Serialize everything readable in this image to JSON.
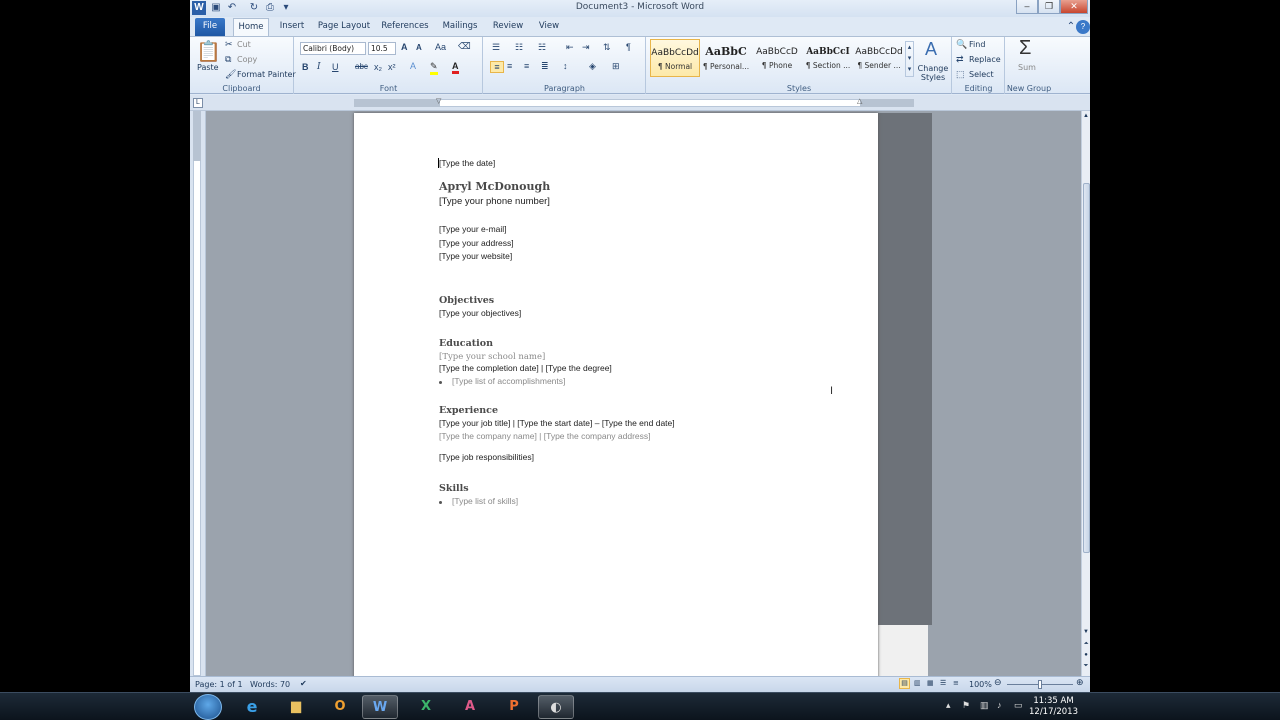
{
  "window": {
    "title": "Document3 - Microsoft Word"
  },
  "tabs": [
    "File",
    "Home",
    "Insert",
    "Page Layout",
    "References",
    "Mailings",
    "Review",
    "View"
  ],
  "clipboard": {
    "paste": "Paste",
    "cut": "Cut",
    "copy": "Copy",
    "format_painter": "Format Painter",
    "label": "Clipboard"
  },
  "font": {
    "name": "Calibri (Body)",
    "size": "10.5",
    "label": "Font",
    "bold": "B",
    "italic": "I",
    "underline": "U",
    "strike": "abc",
    "sub": "x₂",
    "sup": "x²",
    "grow": "A",
    "shrink": "A",
    "clear": "Aa"
  },
  "paragraph": {
    "label": "Paragraph",
    "pilcrow": "¶"
  },
  "styles": {
    "label": "Styles",
    "items": [
      {
        "preview": "AaBbCcDd",
        "name": "¶ Normal"
      },
      {
        "preview": "AaBbC",
        "name": "¶ Personal..."
      },
      {
        "preview": "AaBbCcD",
        "name": "¶ Phone"
      },
      {
        "preview": "AaBbCcI",
        "name": "¶ Section ..."
      },
      {
        "preview": "AaBbCcDd",
        "name": "¶ Sender ..."
      }
    ],
    "change": "Change Styles"
  },
  "editing": {
    "label": "Editing",
    "find": "Find",
    "replace": "Replace",
    "select": "Select"
  },
  "newgroup": {
    "label": "New Group",
    "sum": "Sum"
  },
  "document": {
    "date": "[Type the date]",
    "name": "Apryl McDonough",
    "phone": "[Type your phone number]",
    "email": "[Type your e-mail]",
    "address": "[Type your address]",
    "website": "[Type your website]",
    "h_objectives": "Objectives",
    "objectives": "[Type your objectives]",
    "h_education": "Education",
    "school": "[Type your school name]",
    "completion": "[Type the completion date]  |  [Type the degree]",
    "accomplishments": "[Type list of accomplishments]",
    "h_experience": "Experience",
    "job": "[Type your job title]  |  [Type the start date] – [Type the end date]",
    "company": "[Type the company name]  |  [Type the company address]",
    "responsibilities": "[Type job responsibilities]",
    "h_skills": "Skills",
    "skills": "[Type list of skills]"
  },
  "status": {
    "page": "Page: 1 of 1",
    "words": "Words: 70",
    "zoom": "100%"
  },
  "clock": {
    "time": "11:35 AM",
    "date": "12/17/2013"
  }
}
